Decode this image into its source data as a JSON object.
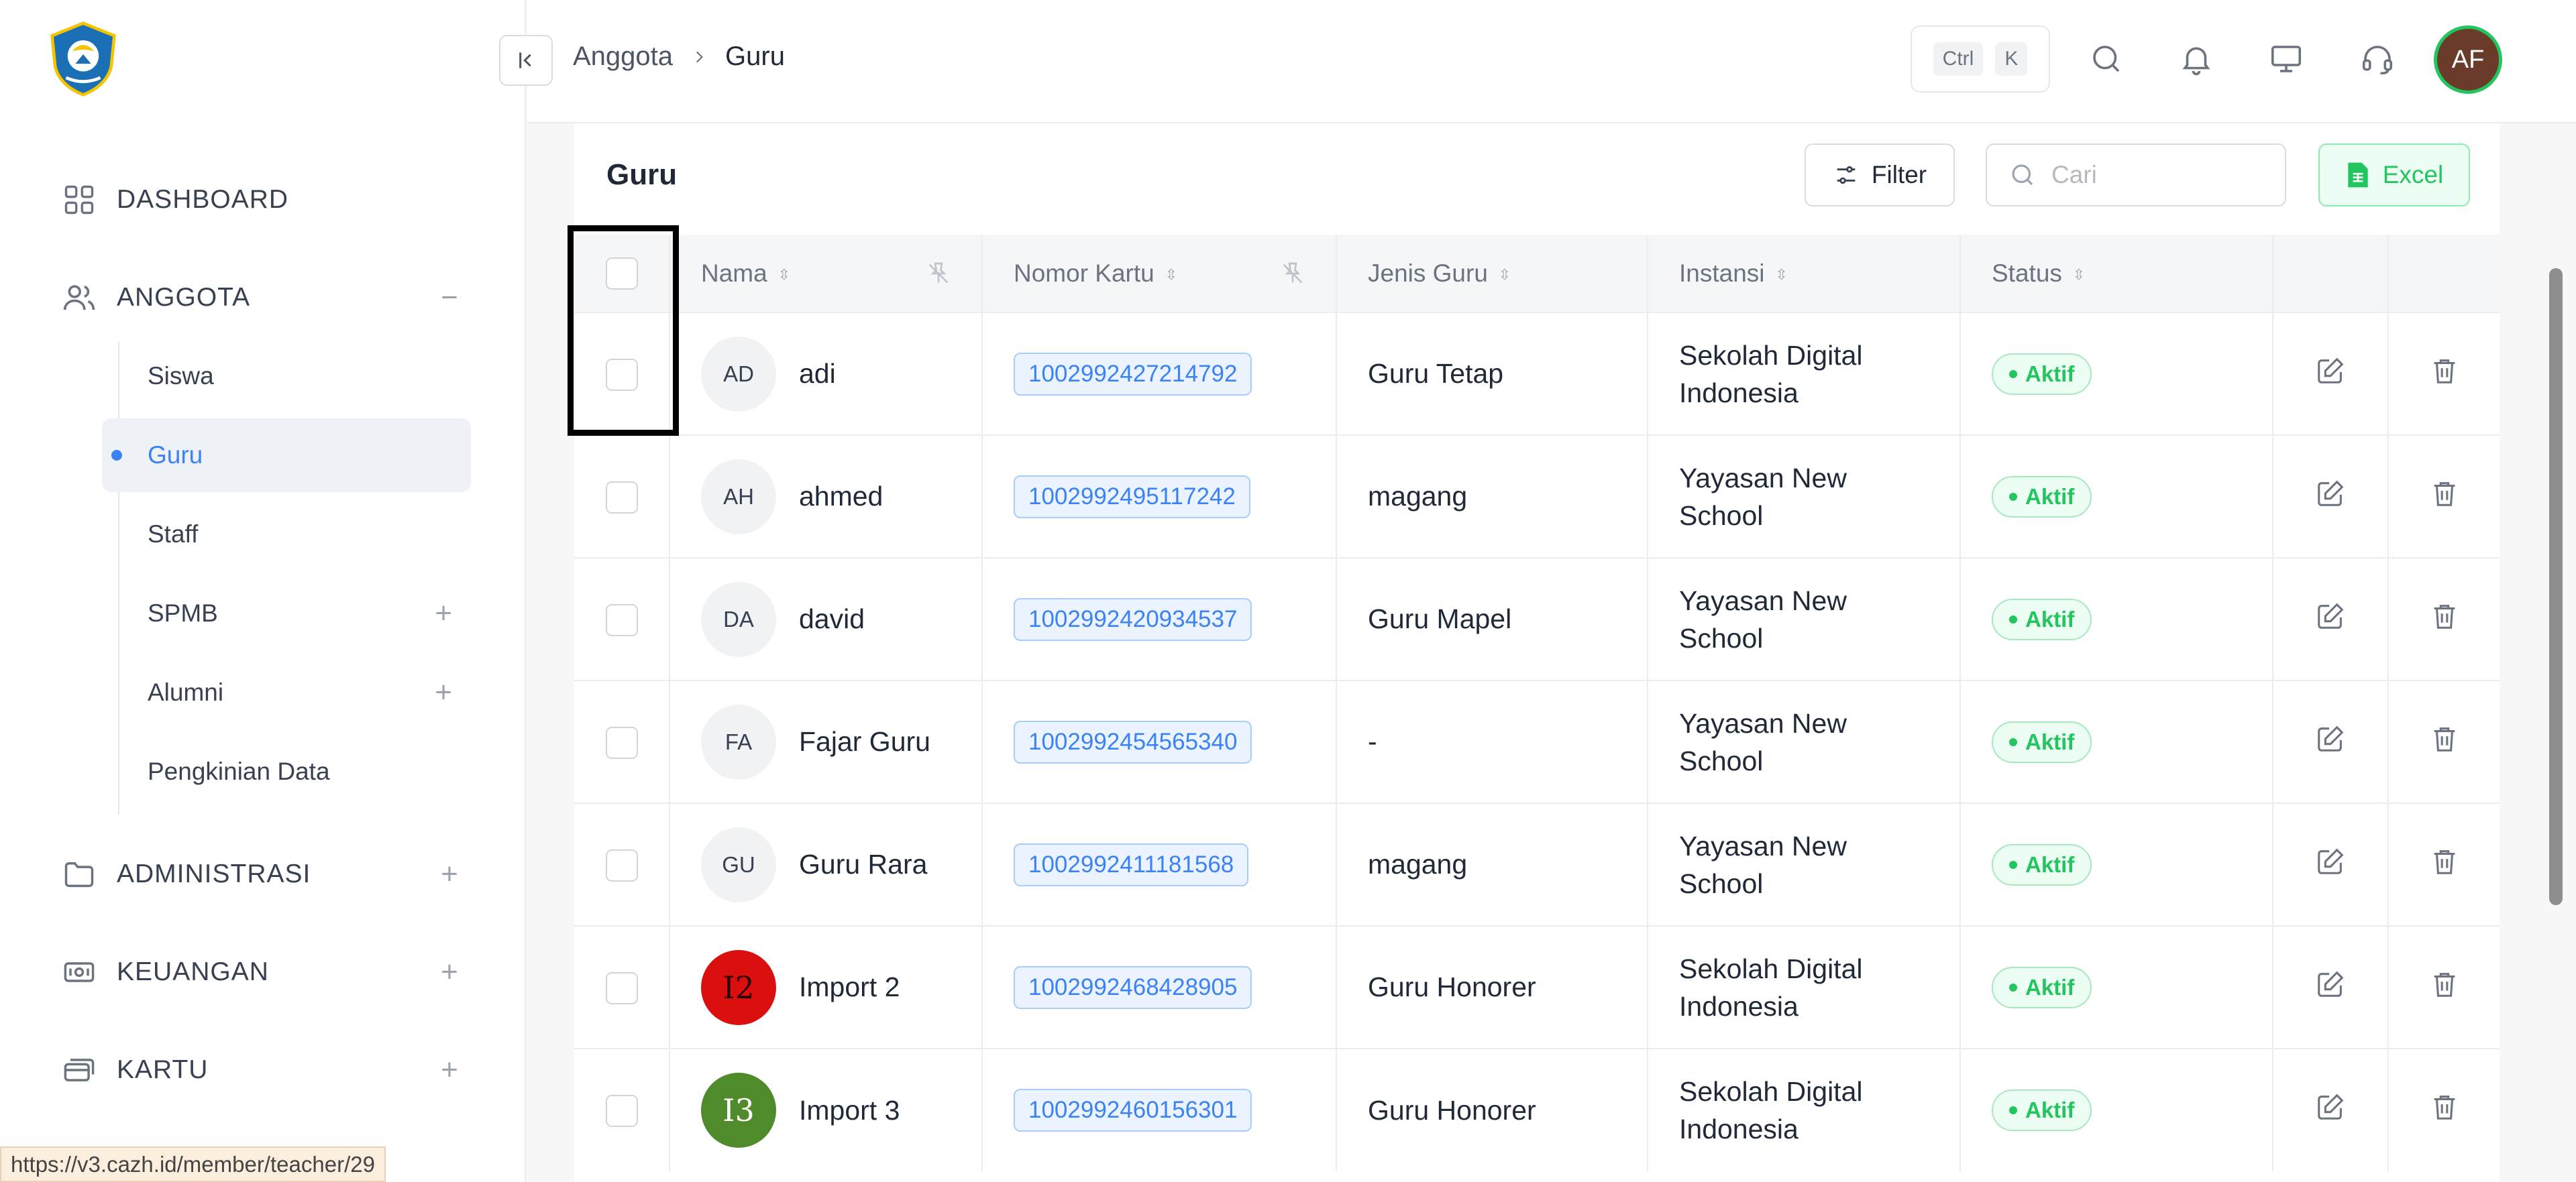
{
  "sidebar": {
    "logo_icon": "tut-wuri-handayani-logo",
    "items": [
      {
        "label": "DASHBOARD",
        "icon": "grid-icon",
        "toggle": ""
      },
      {
        "label": "ANGGOTA",
        "icon": "users-icon",
        "toggle": "−"
      },
      {
        "label": "ADMINISTRASI",
        "icon": "folder-icon",
        "toggle": "+"
      },
      {
        "label": "KEUANGAN",
        "icon": "cash-icon",
        "toggle": "+"
      },
      {
        "label": "KARTU",
        "icon": "cards-icon",
        "toggle": "+"
      }
    ],
    "sub_items": [
      {
        "label": "Siswa",
        "toggle": ""
      },
      {
        "label": "Guru",
        "toggle": "",
        "active": true
      },
      {
        "label": "Staff",
        "toggle": ""
      },
      {
        "label": "SPMB",
        "toggle": "+"
      },
      {
        "label": "Alumni",
        "toggle": "+"
      },
      {
        "label": "Pengkinian Data",
        "toggle": ""
      }
    ]
  },
  "header": {
    "breadcrumb": [
      "Anggota",
      "Guru"
    ],
    "shortcut": [
      "Ctrl",
      "K"
    ],
    "user_initials": "AF"
  },
  "main": {
    "title": "Guru",
    "filter_label": "Filter",
    "search_placeholder": "Cari",
    "excel_label": "Excel",
    "columns": [
      "Nama",
      "Nomor Kartu",
      "Jenis Guru",
      "Instansi",
      "Status"
    ],
    "rows": [
      {
        "initials": "AD",
        "name": "adi",
        "card": "1002992427214792",
        "type": "Guru Tetap",
        "inst1": "Sekolah Digital",
        "inst2": "Indonesia",
        "status": "Aktif"
      },
      {
        "initials": "AH",
        "name": "ahmed",
        "card": "1002992495117242",
        "type": "magang",
        "inst1": "Yayasan New",
        "inst2": "School",
        "status": "Aktif"
      },
      {
        "initials": "DA",
        "name": "david",
        "card": "1002992420934537",
        "type": "Guru Mapel",
        "inst1": "Yayasan New",
        "inst2": "School",
        "status": "Aktif"
      },
      {
        "initials": "FA",
        "name": "Fajar Guru",
        "card": "1002992454565340",
        "type": "-",
        "inst1": "Yayasan New",
        "inst2": "School",
        "status": "Aktif"
      },
      {
        "initials": "GU",
        "name": "Guru Rara",
        "card": "1002992411181568",
        "type": "magang",
        "inst1": "Yayasan New",
        "inst2": "School",
        "status": "Aktif"
      },
      {
        "initials": "I2",
        "name": "Import 2",
        "card": "1002992468428905",
        "type": "Guru Honorer",
        "inst1": "Sekolah Digital",
        "inst2": "Indonesia",
        "status": "Aktif"
      },
      {
        "initials": "I3",
        "name": "Import 3",
        "card": "1002992460156301",
        "type": "Guru Honorer",
        "inst1": "Sekolah Digital",
        "inst2": "Indonesia",
        "status": "Aktif"
      }
    ]
  },
  "status_url": "https://v3.cazh.id/member/teacher/29",
  "colors": {
    "accent": "#3b82f6",
    "success": "#22c55e",
    "excel": "#22c55e"
  }
}
